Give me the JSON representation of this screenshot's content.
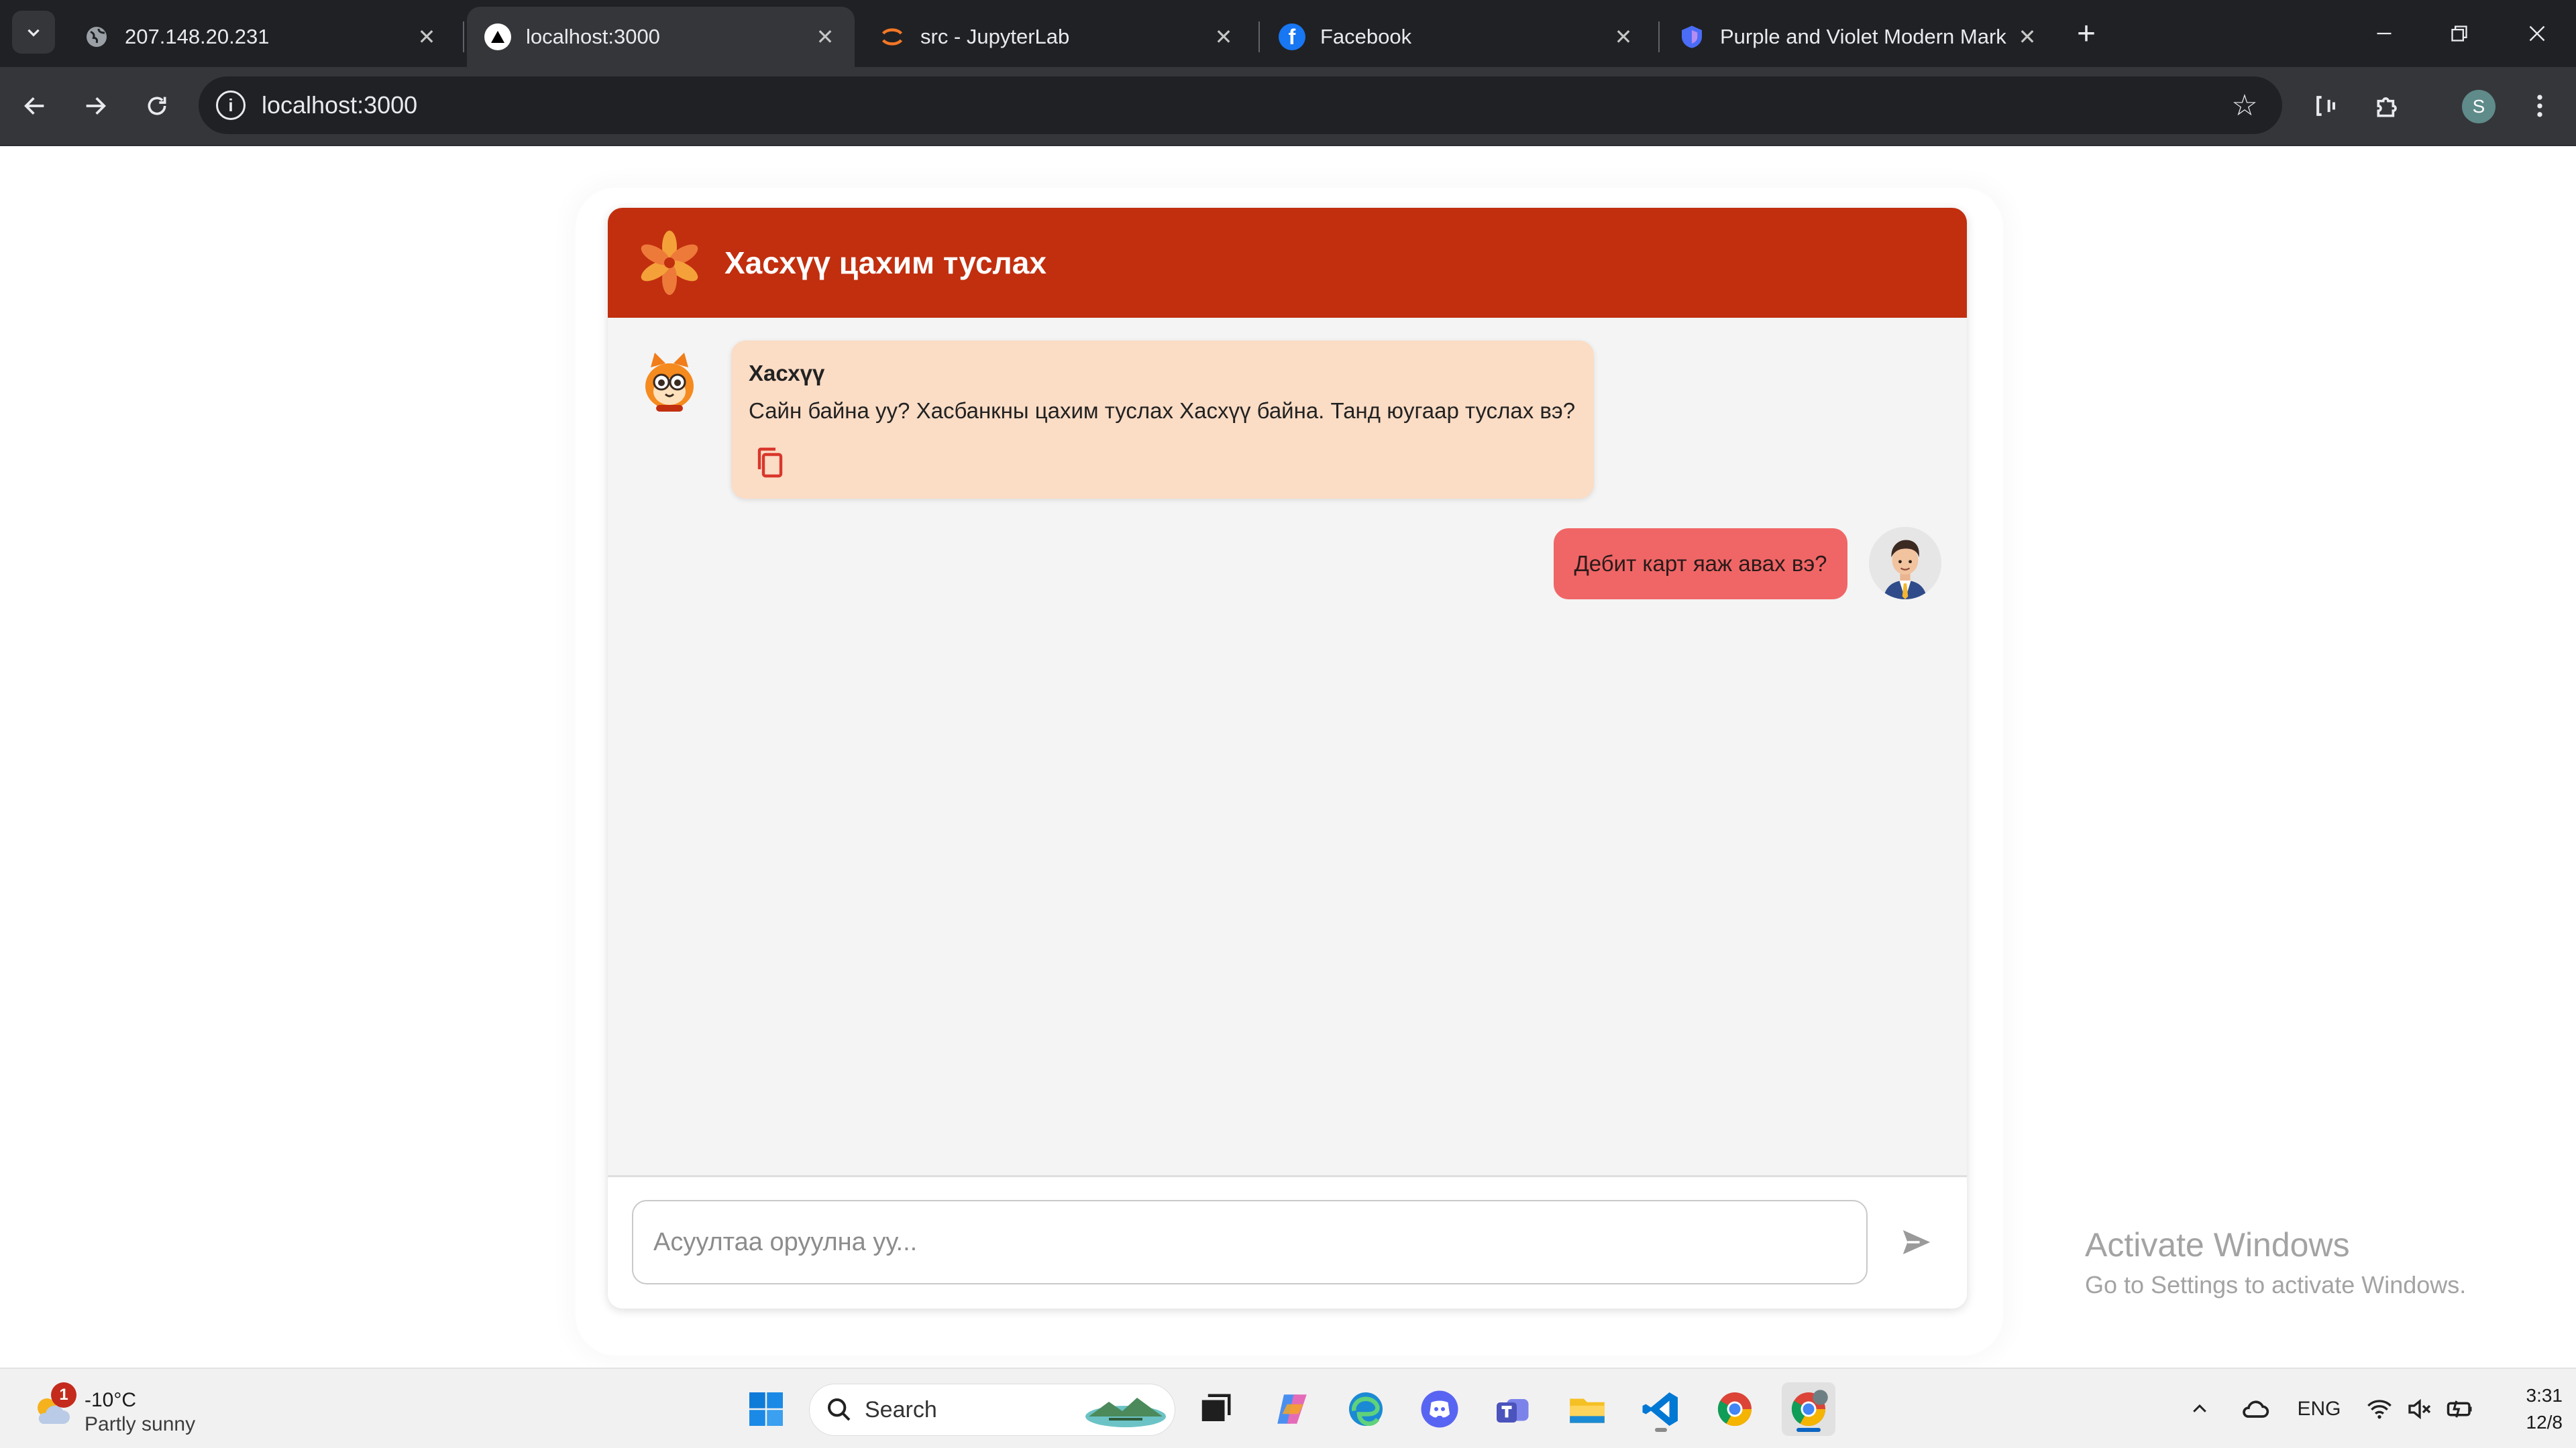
{
  "browser": {
    "tabs": [
      {
        "title": "207.148.20.231",
        "active": false
      },
      {
        "title": "localhost:3000",
        "active": true
      },
      {
        "title": "src - JupyterLab",
        "active": false
      },
      {
        "title": "Facebook",
        "active": false
      },
      {
        "title": "Purple and Violet Modern Mark",
        "active": false
      }
    ],
    "url": "localhost:3000",
    "profile_initial": "S"
  },
  "chat": {
    "header_title": "Хасхүү цахим туслах",
    "bot": {
      "name": "Хасхүү",
      "message": "Сайн байна уу? Хасбанкны цахим туслах Хасхүү байна. Танд юугаар туслах вэ?"
    },
    "user_message": "Дебит карт яаж авах вэ?",
    "input_placeholder": "Асуултаа оруулна уу...",
    "colors": {
      "header": "#c12f0f",
      "bot_bubble": "#fbdcc5",
      "user_bubble": "#f06666"
    }
  },
  "watermark": {
    "title": "Activate Windows",
    "subtitle": "Go to Settings to activate Windows."
  },
  "taskbar": {
    "weather": {
      "badge": "1",
      "temperature": "-10°C",
      "condition": "Partly sunny"
    },
    "search_label": "Search",
    "language": "ENG",
    "time": "3:31",
    "date": "12/8"
  }
}
